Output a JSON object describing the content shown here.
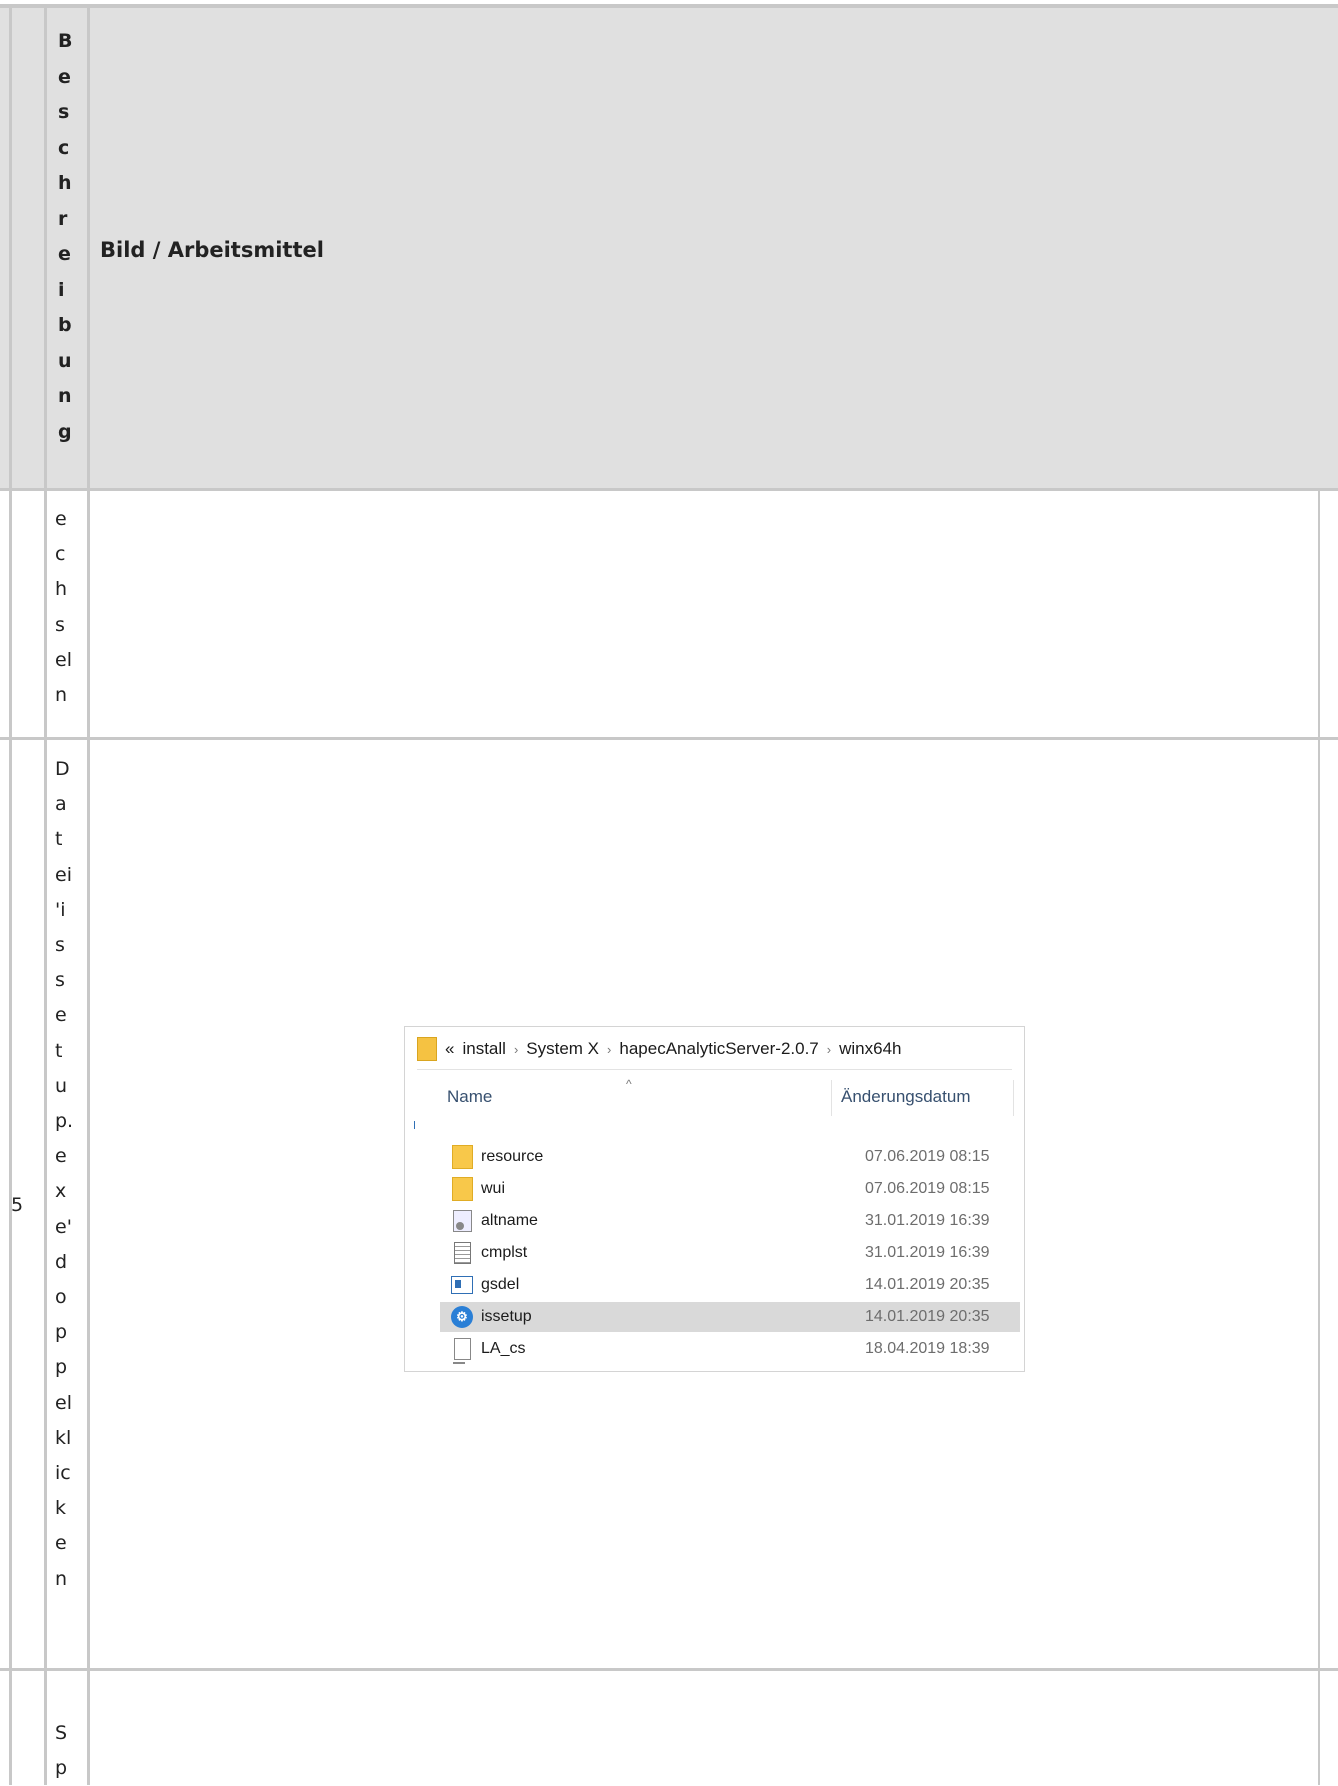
{
  "table": {
    "header": {
      "col1_letters": [
        "B",
        "e",
        "s",
        "c",
        "h",
        "r",
        "e",
        "i",
        "b",
        "u",
        "n",
        "g"
      ],
      "col2_label": "Bild / Arbeitsmittel"
    },
    "row_prev": {
      "col1_letters": [
        "e",
        "c",
        "h",
        "s",
        "el",
        "n"
      ]
    },
    "row5": {
      "number": "5",
      "col1_letters": [
        "D",
        "a",
        "t",
        "ei",
        "'i",
        "s",
        "s",
        "e",
        "t",
        "u",
        "p.",
        "e",
        "x",
        "e'",
        "d",
        "o",
        "p",
        "p",
        "el",
        "kl",
        "ic",
        "k",
        "e",
        "n"
      ]
    },
    "row_next": {
      "col1_letters": [
        "S",
        "p"
      ]
    }
  },
  "explorer": {
    "breadcrumb": {
      "overflow": "«",
      "items": [
        "install",
        "System X",
        "hapecAnalyticServer-2.0.7",
        "winx64h"
      ],
      "separator": "›"
    },
    "sort_caret": "^",
    "columns": {
      "name": "Name",
      "date": "Änderungsdatum"
    },
    "files": [
      {
        "name": "resource",
        "date": "07.06.2019 08:15",
        "icon": "folder-icon"
      },
      {
        "name": "wui",
        "date": "07.06.2019 08:15",
        "icon": "folder-icon"
      },
      {
        "name": "altname",
        "date": "31.01.2019 16:39",
        "icon": "config-file-icon"
      },
      {
        "name": "cmplst",
        "date": "31.01.2019 16:39",
        "icon": "text-file-icon"
      },
      {
        "name": "gsdel",
        "date": "14.01.2019 20:35",
        "icon": "application-icon"
      },
      {
        "name": "issetup",
        "date": "14.01.2019 20:35",
        "icon": "setup-icon",
        "selected": true
      },
      {
        "name": "LA_cs",
        "date": "18.04.2019 18:39",
        "icon": "file-icon"
      }
    ]
  }
}
